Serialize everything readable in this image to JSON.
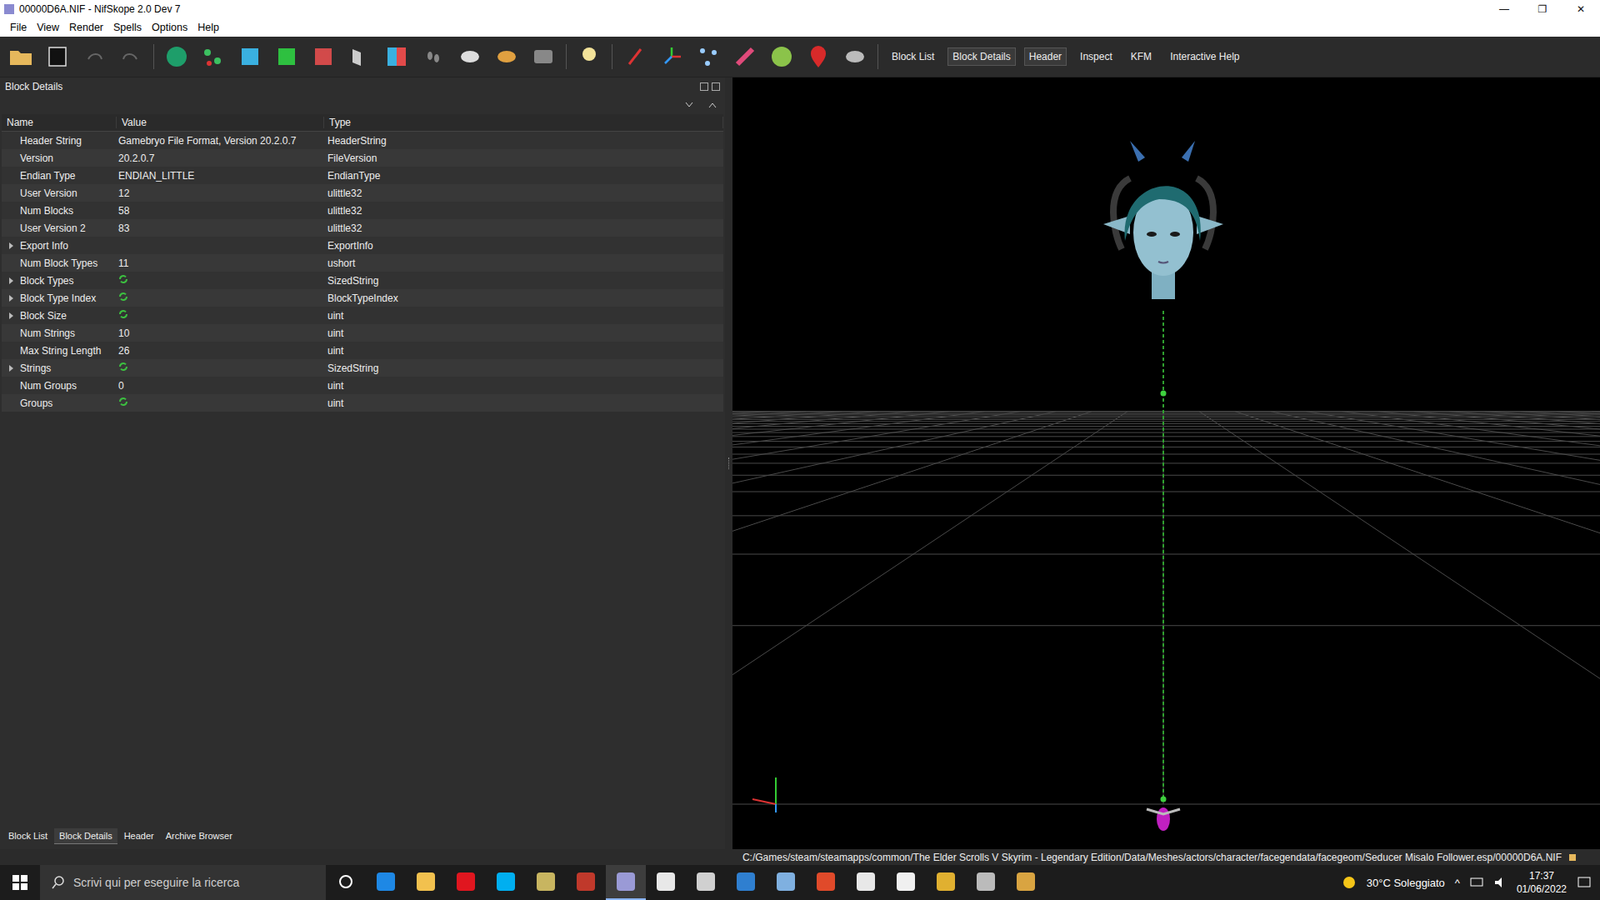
{
  "window": {
    "title": "00000D6A.NIF - NifSkope 2.0 Dev 7",
    "controls": [
      "—",
      "❐",
      "✕"
    ]
  },
  "menu": [
    "File",
    "View",
    "Render",
    "Spells",
    "Options",
    "Help"
  ],
  "toolbar_docks": [
    {
      "label": "Block List",
      "checked": false
    },
    {
      "label": "Block Details",
      "checked": true
    },
    {
      "label": "Header",
      "checked": true
    },
    {
      "label": "Inspect",
      "checked": false
    },
    {
      "label": "KFM",
      "checked": false
    },
    {
      "label": "Interactive Help",
      "checked": false
    }
  ],
  "panel": {
    "title": "Block Details"
  },
  "table": {
    "columns": [
      "Name",
      "Value",
      "Type"
    ],
    "rows": [
      {
        "name": "Header String",
        "value": "Gamebryo File Format, Version 20.2.0.7",
        "type": "HeaderString",
        "expandable": false,
        "expanded": false,
        "kind": "text"
      },
      {
        "name": "Version",
        "value": "20.2.0.7",
        "type": "FileVersion",
        "expandable": false,
        "expanded": false,
        "kind": "text"
      },
      {
        "name": "Endian Type",
        "value": "ENDIAN_LITTLE",
        "type": "EndianType",
        "expandable": false,
        "expanded": false,
        "kind": "text"
      },
      {
        "name": "User Version",
        "value": "12",
        "type": "ulittle32",
        "expandable": false,
        "expanded": false,
        "kind": "text"
      },
      {
        "name": "Num Blocks",
        "value": "58",
        "type": "ulittle32",
        "expandable": false,
        "expanded": false,
        "kind": "text"
      },
      {
        "name": "User Version 2",
        "value": "83",
        "type": "ulittle32",
        "expandable": false,
        "expanded": false,
        "kind": "text"
      },
      {
        "name": "Export Info",
        "value": "",
        "type": "ExportInfo",
        "expandable": true,
        "expanded": false,
        "kind": "text"
      },
      {
        "name": "Num Block Types",
        "value": "11",
        "type": "ushort",
        "expandable": false,
        "expanded": false,
        "kind": "text"
      },
      {
        "name": "Block Types",
        "value": "",
        "type": "SizedString",
        "expandable": true,
        "expanded": false,
        "kind": "array"
      },
      {
        "name": "Block Type Index",
        "value": "",
        "type": "BlockTypeIndex",
        "expandable": true,
        "expanded": false,
        "kind": "array"
      },
      {
        "name": "Block Size",
        "value": "",
        "type": "uint",
        "expandable": true,
        "expanded": false,
        "kind": "array"
      },
      {
        "name": "Num Strings",
        "value": "10",
        "type": "uint",
        "expandable": false,
        "expanded": false,
        "kind": "text"
      },
      {
        "name": "Max String Length",
        "value": "26",
        "type": "uint",
        "expandable": false,
        "expanded": false,
        "kind": "text"
      },
      {
        "name": "Strings",
        "value": "",
        "type": "SizedString",
        "expandable": true,
        "expanded": false,
        "kind": "array"
      },
      {
        "name": "Num Groups",
        "value": "0",
        "type": "uint",
        "expandable": false,
        "expanded": false,
        "kind": "text"
      },
      {
        "name": "Groups",
        "value": "",
        "type": "uint",
        "expandable": false,
        "expanded": false,
        "kind": "array"
      }
    ]
  },
  "bottom_tabs": [
    {
      "label": "Block List",
      "selected": false
    },
    {
      "label": "Block Details",
      "selected": true
    },
    {
      "label": "Header",
      "selected": false
    },
    {
      "label": "Archive Browser",
      "selected": false
    }
  ],
  "status_bar": {
    "path": "C:/Games/steam/steamapps/common/The Elder Scrolls V Skyrim - Legendary Edition/Data/Meshes/actors/character/facegendata/facegeom/Seducer Misalo Follower.esp/00000D6A.NIF"
  },
  "taskbar": {
    "search_placeholder": "Scrivi qui per eseguire la ricerca",
    "apps": [
      {
        "color": "#1e88e5",
        "active": false
      },
      {
        "color": "#f2c14e",
        "active": false
      },
      {
        "color": "#e0161f",
        "active": false
      },
      {
        "color": "#00aff0",
        "active": false
      },
      {
        "color": "#c8b560",
        "active": false
      },
      {
        "color": "#c0392b",
        "active": false
      },
      {
        "color": "#9a9ad6",
        "active": true
      },
      {
        "color": "#e8e8e8",
        "active": false
      },
      {
        "color": "#d0d0d0",
        "active": false
      },
      {
        "color": "#2f7fd0",
        "active": false
      },
      {
        "color": "#7fb0e0",
        "active": false
      },
      {
        "color": "#e04a2a",
        "active": false
      },
      {
        "color": "#e8e8e8",
        "active": false
      },
      {
        "color": "#f0f0f0",
        "active": false
      },
      {
        "color": "#e0b030",
        "active": false
      },
      {
        "color": "#bbbbbb",
        "active": false
      },
      {
        "color": "#d9a441",
        "active": false
      }
    ],
    "weather": "30°C Soleggiato",
    "tray_chevron": "^",
    "time": "17:37",
    "date": "01/06/2022"
  }
}
